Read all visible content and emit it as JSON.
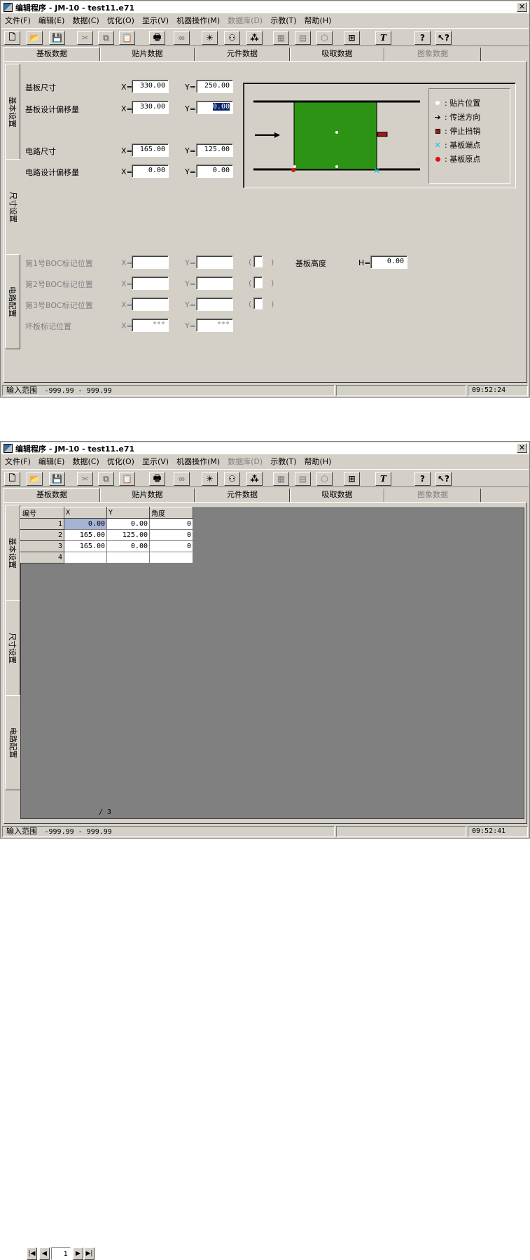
{
  "window": {
    "title": "编辑程序 - JM-10 - test11.e71",
    "close": "✕"
  },
  "menu": [
    "文件(F)",
    "编辑(E)",
    "数据(C)",
    "优化(O)",
    "显示(V)",
    "机器操作(M)",
    "数据库(D)",
    "示教(T)",
    "帮助(H)"
  ],
  "menu_disabled": [
    6
  ],
  "toolbar": [
    "new-icon",
    "open-icon",
    "save-icon",
    "cut-icon",
    "copy-icon",
    "paste-icon",
    "print-icon",
    "binoculars-icon",
    "lightbulb-icon",
    "nozzle-icon",
    "parts-icon",
    "board-icon",
    "pcb-grid-icon",
    "cube-icon",
    "camera-target-icon",
    "text-icon",
    "help-icon",
    "whats-this-icon"
  ],
  "tabs": [
    "基板数据",
    "贴片数据",
    "元件数据",
    "吸取数据",
    "图象数据"
  ],
  "side_tabs": [
    "基本设置",
    "尺寸设置",
    "电路配置"
  ],
  "form": {
    "board_size": {
      "label": "基板尺寸",
      "x": "330.00",
      "y": "250.00"
    },
    "board_offset": {
      "label": "基板设计偏移量",
      "x": "330.00",
      "y": "0.00"
    },
    "circuit_size": {
      "label": "电路尺寸",
      "x": "165.00",
      "y": "125.00"
    },
    "circuit_offset": {
      "label": "电路设计偏移量",
      "x": "0.00",
      "y": "0.00"
    },
    "boc1": {
      "label": "第1号BOC标记位置",
      "x": "",
      "y": ""
    },
    "boc2": {
      "label": "第2号BOC标记位置",
      "x": "",
      "y": ""
    },
    "boc3": {
      "label": "第3号BOC标记位置",
      "x": "",
      "y": ""
    },
    "bad_mark": {
      "label": "坏板标记位置",
      "x": "***",
      "y": "***"
    },
    "board_height": {
      "label": "基板高度",
      "h_label": "H=",
      "h": "0.00"
    },
    "x_label": "X=",
    "y_label": "Y=",
    "paren_open": "(",
    "paren_close": ")"
  },
  "legend": [
    {
      "icon": "white-dot",
      "label": ": 贴片位置"
    },
    {
      "icon": "arrow",
      "label": ": 传送方向"
    },
    {
      "icon": "red-square",
      "label": ": 停止挡销"
    },
    {
      "icon": "cyan-x",
      "label": ": 基板端点"
    },
    {
      "icon": "red-dot",
      "label": ": 基板原点"
    }
  ],
  "colors": {
    "board": "#2d9314",
    "stopper": "#a01818",
    "origin": "#e01010",
    "endpoint": "#00c8e0"
  },
  "status": {
    "range_label": "输入范围",
    "range": "-999.99 - 999.99",
    "time1": "09:52:24",
    "time2": "09:52:41"
  },
  "grid": {
    "headers": [
      "编号",
      "X",
      "Y",
      "角度"
    ],
    "rows": [
      {
        "n": "1",
        "x": "0.00",
        "y": "0.00",
        "a": "0"
      },
      {
        "n": "2",
        "x": "165.00",
        "y": "125.00",
        "a": "0"
      },
      {
        "n": "3",
        "x": "165.00",
        "y": "0.00",
        "a": "0"
      },
      {
        "n": "4",
        "x": "",
        "y": "",
        "a": ""
      }
    ]
  },
  "pager": {
    "page": "1",
    "total": "/ 3"
  }
}
